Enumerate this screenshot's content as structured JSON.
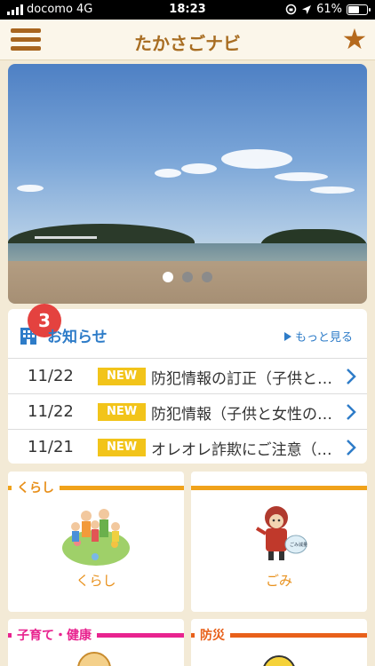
{
  "status_bar": {
    "carrier": "docomo",
    "network": "4G",
    "time": "18:23",
    "battery_text": "61%",
    "battery_level": 0.61
  },
  "header": {
    "title": "たかさごナビ",
    "menu_icon": "hamburger-icon",
    "favorite_icon": "star-icon"
  },
  "hero": {
    "slide_count": 3,
    "active_slide": 0
  },
  "news": {
    "badge_count": "3",
    "title": "お知らせ",
    "more_label": "もっと見る",
    "new_label": "NEW",
    "items": [
      {
        "date": "11/22",
        "text": "防犯情報の訂正（子供と女性の安全）"
      },
      {
        "date": "11/22",
        "text": "防犯情報（子供と女性の安全）"
      },
      {
        "date": "11/21",
        "text": "オレオレ詐欺にご注意（高砂署）"
      }
    ]
  },
  "categories": [
    {
      "tag": "くらし",
      "caption": "くらし",
      "color": "#f0a21a"
    },
    {
      "tag": "",
      "caption": "ごみ",
      "color": "#f0a21a"
    },
    {
      "tag": "子育て・健康",
      "caption": "",
      "color": "#e8238f"
    },
    {
      "tag": "防災",
      "caption": "",
      "color": "#e8601a"
    }
  ],
  "colors": {
    "accent": "#a86d22",
    "link": "#2e7cc8",
    "badge": "#e4423f",
    "new_badge": "#f2c41a"
  }
}
